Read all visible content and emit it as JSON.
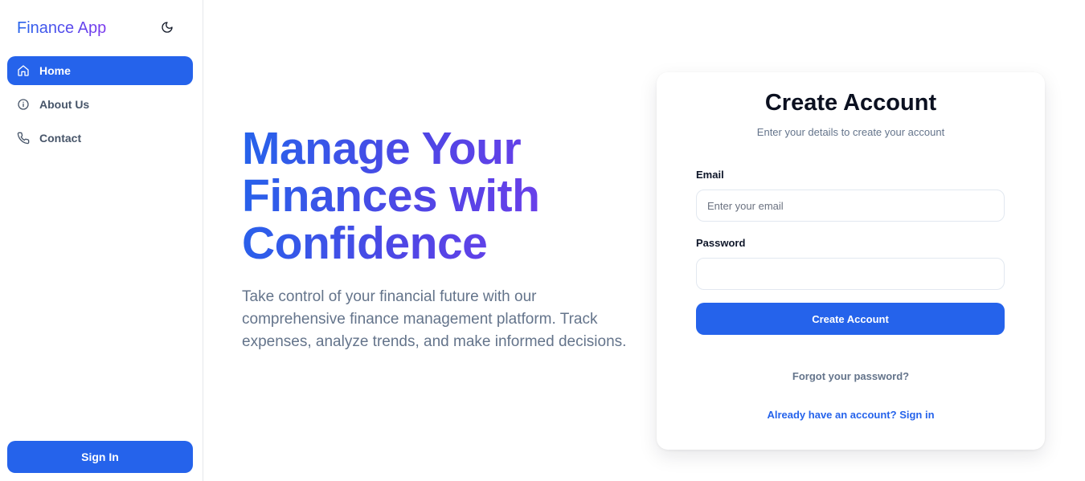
{
  "app": {
    "brand": "Finance App",
    "theme_toggle_icon": "moon-icon"
  },
  "sidebar": {
    "items": [
      {
        "label": "Home",
        "icon": "home-icon",
        "active": true
      },
      {
        "label": "About Us",
        "icon": "info-icon",
        "active": false
      },
      {
        "label": "Contact",
        "icon": "phone-icon",
        "active": false
      }
    ],
    "signin_label": "Sign In"
  },
  "hero": {
    "title": "Manage Your Finances with Confidence",
    "description": "Take control of your financial future with our comprehensive finance management platform. Track expenses, analyze trends, and make informed decisions."
  },
  "form": {
    "title": "Create Account",
    "subtitle": "Enter your details to create your account",
    "email_label": "Email",
    "email_placeholder": "Enter your email",
    "email_value": "",
    "password_label": "Password",
    "password_value": "",
    "submit_label": "Create Account",
    "forgot_label": "Forgot your password?",
    "signin_link_label": "Already have an account? Sign in"
  },
  "colors": {
    "primary": "#2563eb",
    "accent": "#7c3aed",
    "muted_text": "#64748b"
  }
}
